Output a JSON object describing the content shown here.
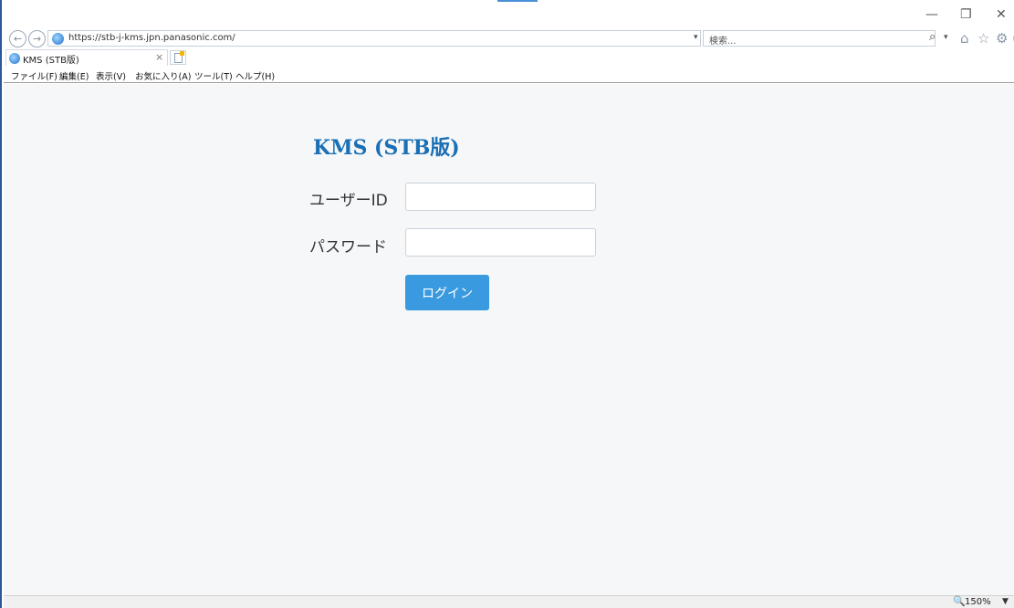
{
  "browser": {
    "url": "https://stb-j-kms.jpn.panasonic.com/",
    "search_placeholder": "検索...",
    "tab_title": "KMS (STB版)",
    "menu": [
      "ファイル(F)",
      "編集(E)",
      "表示(V)",
      "お気に入り(A)",
      "ツール(T)",
      "ヘルプ(H)"
    ],
    "zoom": "150%",
    "icons": [
      "back-icon",
      "forward-icon",
      "page-icon",
      "lock-icon",
      "refresh-icon",
      "search-icon",
      "home-icon",
      "star-icon",
      "gear-icon",
      "smiley-icon",
      "minimize-icon",
      "restore-icon",
      "close-icon",
      "new-tab-icon",
      "zoom-icon"
    ]
  },
  "login": {
    "title": "KMS (STB版)",
    "user_label": "ユーザーID",
    "password_label": "パスワード",
    "user_value": "",
    "password_value": "",
    "button_label": "ログイン",
    "accent_color": "#3a9ae0",
    "title_color": "#1a6fb5"
  }
}
